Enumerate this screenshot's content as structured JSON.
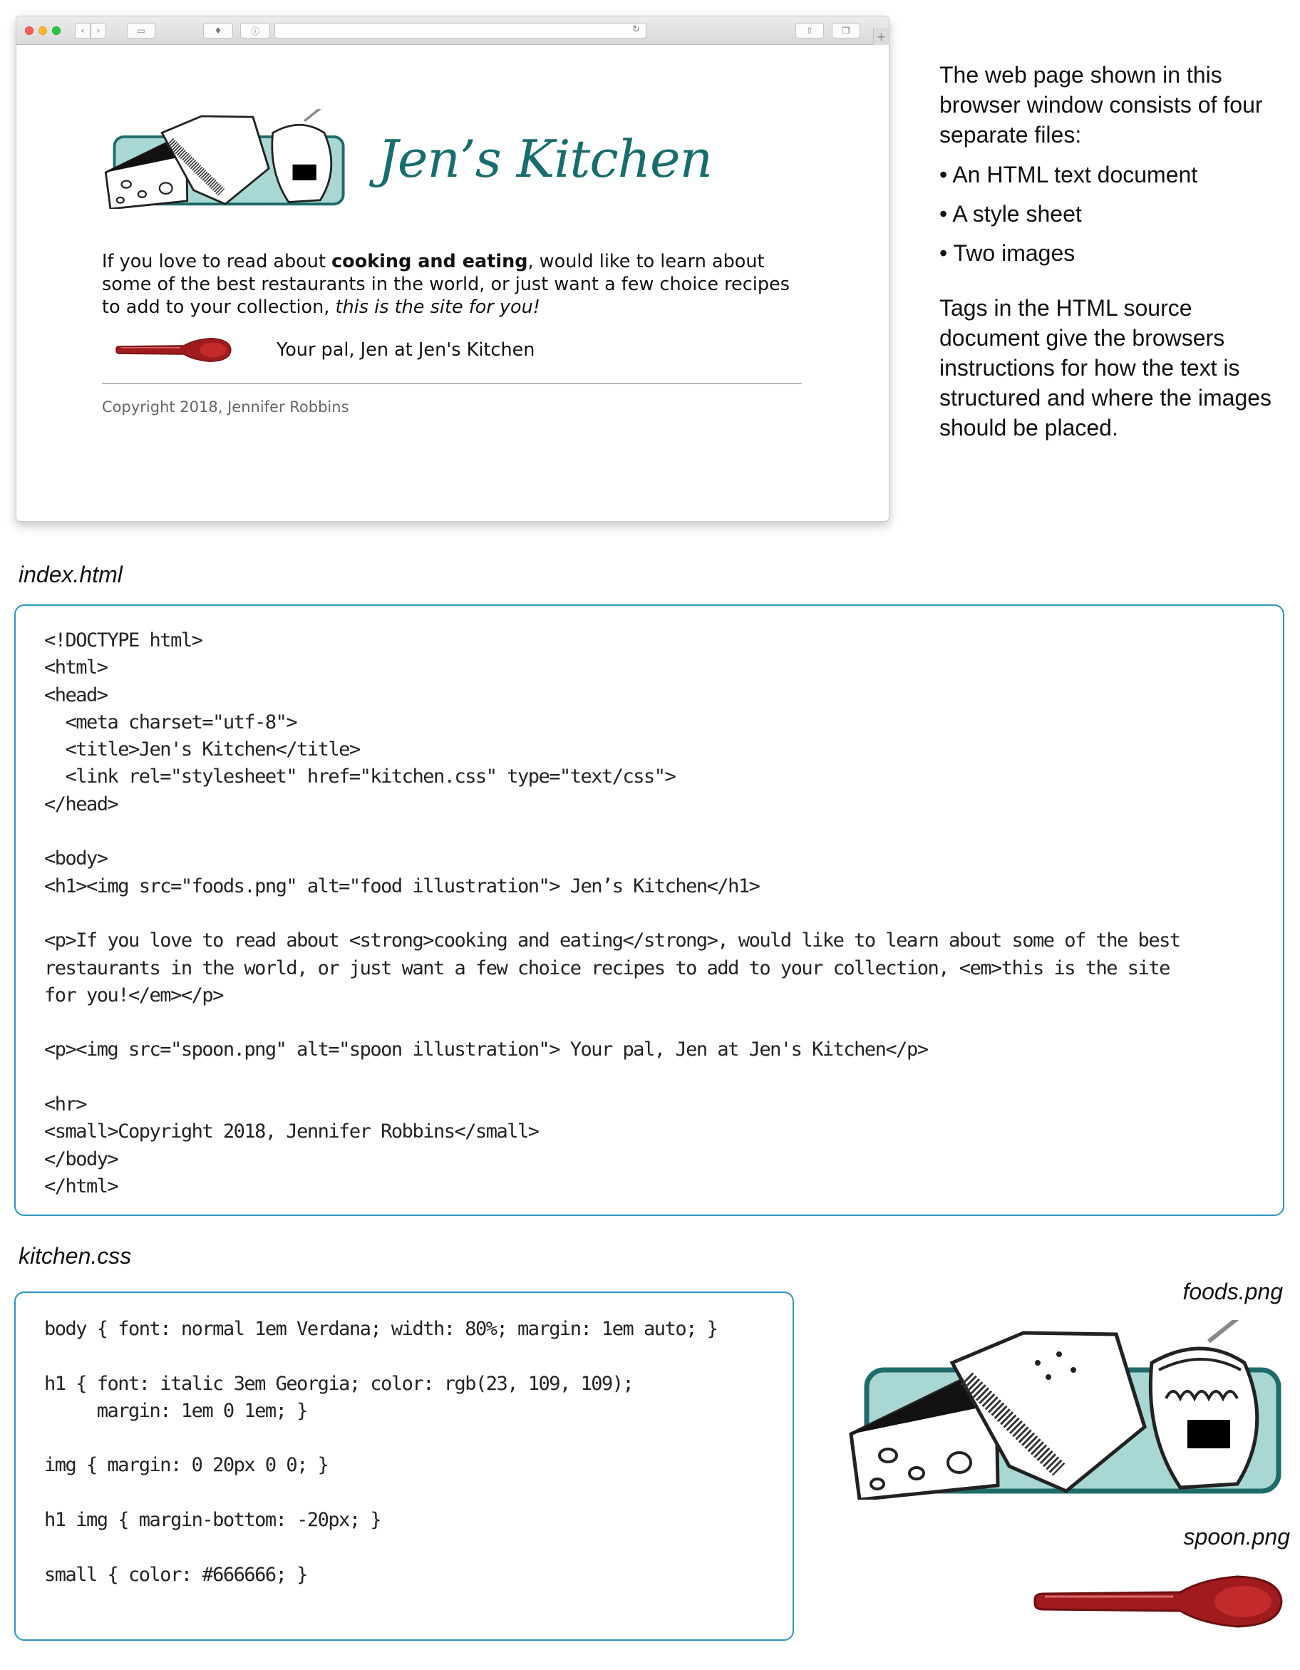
{
  "browser": {
    "toolbar_icons": {
      "back": "‹",
      "forward": "›",
      "sidebar": "▭",
      "extension": "♦",
      "info": "ⓘ",
      "reload": "↻",
      "share": "⇧",
      "tabs": "❐",
      "new_tab": "+"
    },
    "page": {
      "h1_text": "Jen’s Kitchen",
      "p_before": "If you love to read about ",
      "p_strong": "cooking and eating",
      "p_middle": ", would like to learn about some of the best restaurants in the world, or just want a few choice recipes to add to your collection, ",
      "p_em": "this is the site for you!",
      "pal_text": "Your pal, Jen at Jen's Kitchen",
      "copyright": "Copyright 2018, Jennifer Robbins"
    }
  },
  "description": {
    "intro": "The web page shown in this browser window consists of four separate files:",
    "bullets": [
      "• An HTML text document",
      "• A style sheet",
      "• Two images"
    ],
    "outro": "Tags in the HTML source document give the browsers instructions for how the text is structured and where the images should be placed."
  },
  "files": {
    "html_name": "index.html",
    "html_code": "<!DOCTYPE html>\n<html>\n<head>\n  <meta charset=\"utf-8\">\n  <title>Jen's Kitchen</title>\n  <link rel=\"stylesheet\" href=\"kitchen.css\" type=\"text/css\">\n</head>\n\n<body>\n<h1><img src=\"foods.png\" alt=\"food illustration\"> Jen’s Kitchen</h1>\n\n<p>If you love to read about <strong>cooking and eating</strong>, would like to learn about some of the best\nrestaurants in the world, or just want a few choice recipes to add to your collection, <em>this is the site\nfor you!</em></p>\n\n<p><img src=\"spoon.png\" alt=\"spoon illustration\"> Your pal, Jen at Jen's Kitchen</p>\n\n<hr>\n<small>Copyright 2018, Jennifer Robbins</small>\n</body>\n</html>",
    "css_name": "kitchen.css",
    "css_code": "body { font: normal 1em Verdana; width: 80%; margin: 1em auto; }\n\nh1 { font: italic 3em Georgia; color: rgb(23, 109, 109);\n     margin: 1em 0 1em; }\n\nimg { margin: 0 20px 0 0; }\n\nh1 img { margin-bottom: -20px; }\n\nsmall { color: #666666; }",
    "foods_name": "foods.png",
    "spoon_name": "spoon.png"
  },
  "colors": {
    "heading_teal": "#176d6d",
    "box_border": "#2a95c2",
    "small_gray": "#666666",
    "spoon_red": "#a01b1e",
    "foods_panel": "#a9d7d3"
  }
}
